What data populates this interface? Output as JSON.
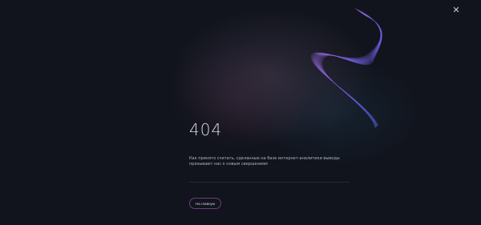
{
  "close": {
    "icon": "close-icon",
    "glyph": "✕"
  },
  "error": {
    "code": "404",
    "message_line1": "Как принято считать, сделанные на базе интернет-аналитики выводы",
    "message_line2": "призывают нас к новым свершениям"
  },
  "home_button": {
    "label": "На главную"
  },
  "colors": {
    "background": "#11141d",
    "accent_button_border": "#6a3f78",
    "wave_primary": "#6e5be0",
    "wave_secondary": "#a36ad6"
  }
}
